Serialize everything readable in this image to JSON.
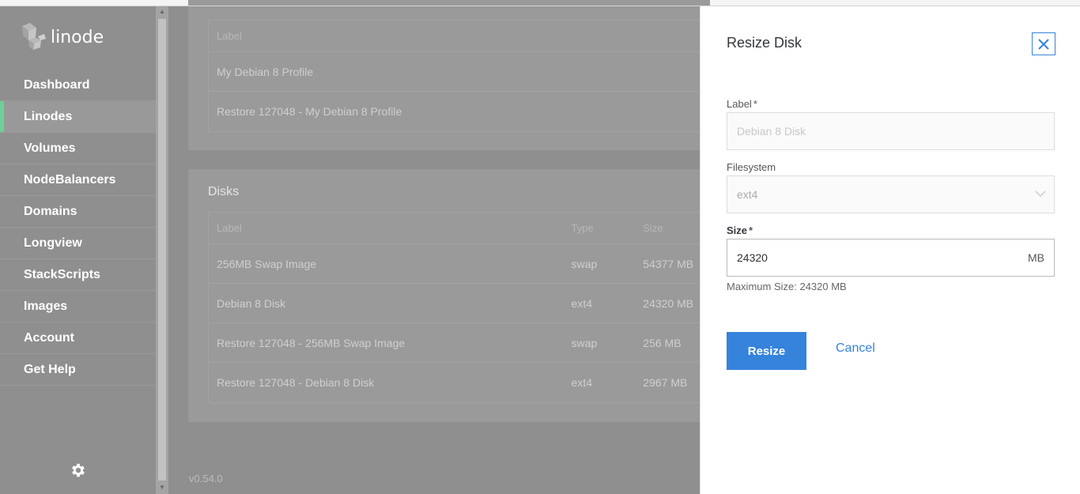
{
  "sidebar": {
    "logo_text": "linode",
    "items": [
      {
        "label": "Dashboard"
      },
      {
        "label": "Linodes"
      },
      {
        "label": "Volumes"
      },
      {
        "label": "NodeBalancers"
      },
      {
        "label": "Domains"
      },
      {
        "label": "Longview"
      },
      {
        "label": "StackScripts"
      },
      {
        "label": "Images"
      },
      {
        "label": "Account"
      },
      {
        "label": "Get Help"
      }
    ],
    "active_item": "Linodes",
    "settings_icon": "gear-icon"
  },
  "configs_table": {
    "header": "Label",
    "rows": [
      "My Debian 8 Profile",
      "Restore 127048 - My Debian 8 Profile"
    ]
  },
  "disks": {
    "title": "Disks",
    "columns": {
      "label": "Label",
      "type": "Type",
      "size": "Size"
    },
    "rows": [
      {
        "label": "256MB Swap Image",
        "type": "swap",
        "size": "54377 MB"
      },
      {
        "label": "Debian 8 Disk",
        "type": "ext4",
        "size": "24320 MB"
      },
      {
        "label": "Restore 127048 - 256MB Swap Image",
        "type": "swap",
        "size": "256 MB"
      },
      {
        "label": "Restore 127048 - Debian 8 Disk",
        "type": "ext4",
        "size": "2967 MB"
      }
    ]
  },
  "footer": {
    "version": "v0.54.0"
  },
  "drawer": {
    "title": "Resize Disk",
    "label_field": {
      "label": "Label",
      "required_mark": "*",
      "value": "Debian 8 Disk"
    },
    "filesystem_field": {
      "label": "Filesystem",
      "value": "ext4"
    },
    "size_field": {
      "label": "Size",
      "required_mark": "*",
      "value": "24320",
      "unit": "MB"
    },
    "helper_text": "Maximum Size: 24320 MB",
    "resize_button": "Resize",
    "cancel_button": "Cancel"
  },
  "colors": {
    "accent": "#3683dc",
    "active_indicator": "#6fcf97"
  }
}
